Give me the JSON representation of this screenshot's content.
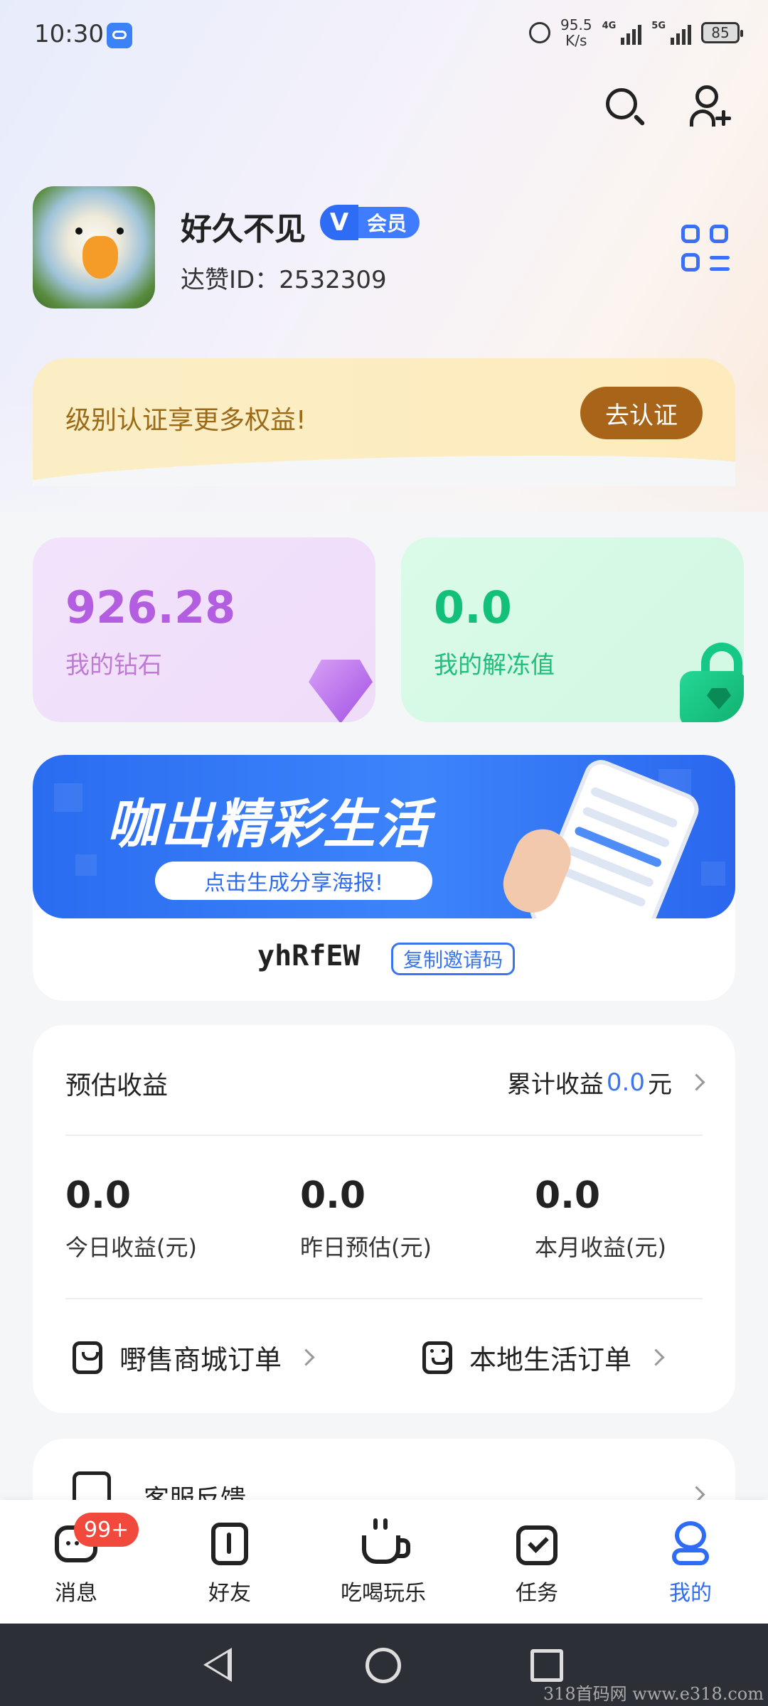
{
  "status_bar": {
    "time": "10:30",
    "net_speed": "95.5",
    "net_unit": "K/s",
    "signal1_label": "4G",
    "signal2_label": "5G",
    "battery": "85"
  },
  "profile": {
    "username": "好久不见",
    "vip_label": "会员",
    "vip_v": "V",
    "user_id": "达赞ID：2532309"
  },
  "cert_banner": {
    "text": "级别认证享更多权益!",
    "button": "去认证"
  },
  "cards": {
    "diamond_value": "926.28",
    "diamond_label": "我的钻石",
    "unfreeze_value": "0.0",
    "unfreeze_label": "我的解冻值"
  },
  "promo": {
    "title": "咖出精彩生活",
    "button": "点击生成分享海报!",
    "invite_code": "yhRfEW",
    "copy_button": "复制邀请码"
  },
  "earnings": {
    "title": "预估收益",
    "total_prefix": "累计收益",
    "total_value": "0.0",
    "total_unit": "元",
    "stats": [
      {
        "value": "0.0",
        "label": "今日收益(元)"
      },
      {
        "value": "0.0",
        "label": "昨日预估(元)"
      },
      {
        "value": "0.0",
        "label": "本月收益(元)"
      }
    ],
    "order_mall": "嘢售商城订单",
    "order_local": "本地生活订单"
  },
  "feedback": {
    "label": "客服反馈"
  },
  "tabbar": {
    "badge": "99+",
    "tabs": [
      {
        "label": "消息",
        "icon": "message-icon"
      },
      {
        "label": "好友",
        "icon": "friends-icon"
      },
      {
        "label": "吃喝玩乐",
        "icon": "cup-icon"
      },
      {
        "label": "任务",
        "icon": "task-icon"
      },
      {
        "label": "我的",
        "icon": "profile-icon"
      }
    ],
    "active": "我的"
  },
  "watermark": "318首码网 www.e318.com",
  "colors": {
    "accent": "#2f6cf6",
    "diamond": "#b35ee0",
    "unfreeze": "#12c07a",
    "cert_button": "#a8651a",
    "badge": "#f14a3d"
  }
}
